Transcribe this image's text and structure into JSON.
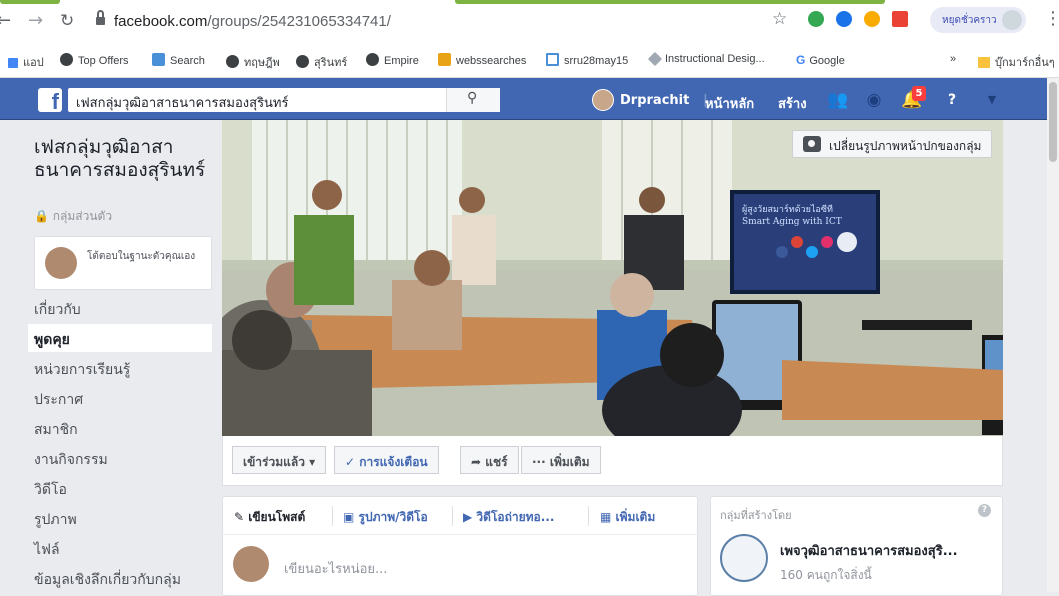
{
  "browser": {
    "url_host": "facebook.com",
    "url_path": "/groups/254231065334741/",
    "profile_label": "หยุดชั่วคราว",
    "bookmarks": [
      {
        "label": "แอป"
      },
      {
        "label": "Top Offers"
      },
      {
        "label": "Search"
      },
      {
        "label": "ทฤษฎีพ"
      },
      {
        "label": "สุรินทร์"
      },
      {
        "label": "Empire"
      },
      {
        "label": "webssearches"
      },
      {
        "label": "srru28may15"
      },
      {
        "label": "Instructional Desig..."
      },
      {
        "label": "Google"
      },
      {
        "label": "»"
      },
      {
        "label": "บุ๊กมาร์กอื่นๆ"
      }
    ]
  },
  "fb": {
    "search_value": "เฟสกลุ่มวุฒิอาสาธนาคารสมองสุรินทร์",
    "user_name": "Drprachit",
    "nav_home": "หน้าหลัก",
    "nav_create": "สร้าง",
    "notif_count": "5",
    "brand_color": "#4267b2"
  },
  "group": {
    "name": "เฟสกลุ่มวุฒิอาสาธนาคารสมองสุรินทร์",
    "privacy": "🔒 กลุ่มส่วนตัว",
    "answer_prompt": "โต้ตอบในฐานะตัวคุณเอง",
    "nav": [
      {
        "label": "เกี่ยวกับ",
        "active": false
      },
      {
        "label": "พูดคุย",
        "active": true
      },
      {
        "label": "หน่วยการเรียนรู้",
        "active": false
      },
      {
        "label": "ประกาศ",
        "active": false
      },
      {
        "label": "สมาชิก",
        "active": false
      },
      {
        "label": "งานกิจกรรม",
        "active": false
      },
      {
        "label": "วิดีโอ",
        "active": false
      },
      {
        "label": "รูปภาพ",
        "active": false
      },
      {
        "label": "ไฟล์",
        "active": false
      },
      {
        "label": "ข้อมูลเชิงลึกเกี่ยวกับกลุ่ม",
        "active": false
      }
    ]
  },
  "cover": {
    "change_button": "เปลี่ยนรูปภาพหน้าปกของกลุ่ม",
    "tv_line1": "ผู้สูงวัยสมาร์ทด้วยไอซีที",
    "tv_line2": "Smart Aging with ICT"
  },
  "actions": {
    "joined": "เข้าร่วมแล้ว ▾",
    "notifications": "✓ การแจ้งเตือน",
    "share": "➦ แชร์",
    "more": "··· เพิ่มเติม"
  },
  "composer": {
    "tabs": [
      "✎ เขียนโพสต์",
      "▣ รูปภาพ/วิดีโอ",
      "▶ วิดีโอถ่ายทอ...",
      "▦ เพิ่มเติม"
    ],
    "placeholder": "เขียนอะไรหน่อย..."
  },
  "created_by": {
    "title": "กลุ่มที่สร้างโดย",
    "page_name": "เพจวุฒิอาสาธนาคารสมองสุริ...",
    "likes": "160 คนถูกใจสิ่งนี้"
  }
}
